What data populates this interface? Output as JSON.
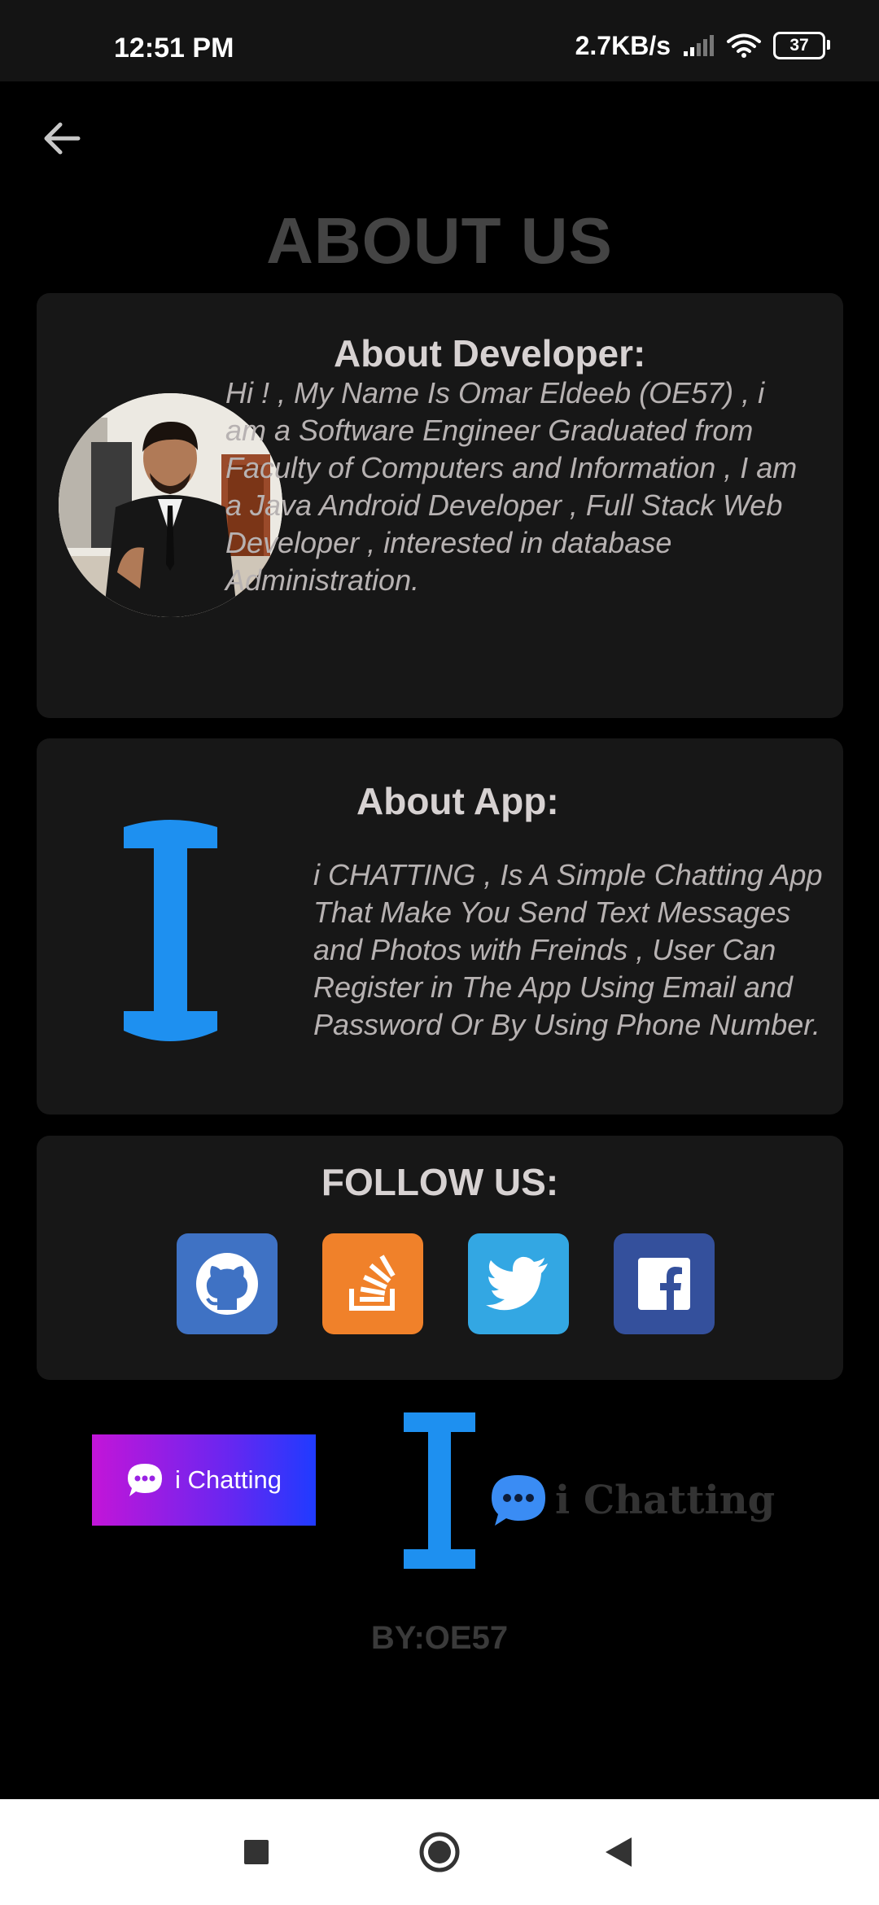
{
  "status": {
    "time": "12:51 PM",
    "net_speed": "2.7KB/s",
    "battery": "37"
  },
  "page": {
    "title": "ABOUT US"
  },
  "developer": {
    "heading": "About Developer:",
    "bio": "Hi ! , My Name Is Omar Eldeeb (OE57) , i am a Software Engineer Graduated from Faculty of Computers and Information , I am a Java Android Developer  , Full Stack Web Developer , interested in database Administration."
  },
  "app": {
    "heading": "About App:",
    "description": "i CHATTING ,  Is A Simple Chatting App That Make You Send  Text Messages and Photos with Freinds , User Can Register in The App Using Email and Password Or By Using Phone Number."
  },
  "follow": {
    "heading": "FOLLOW US:",
    "links": [
      {
        "name": "github",
        "icon": "github-icon",
        "color": "#3f72c4"
      },
      {
        "name": "stackoverflow",
        "icon": "stackoverflow-icon",
        "color": "#f0812a"
      },
      {
        "name": "twitter",
        "icon": "twitter-icon",
        "color": "#33a7e3"
      },
      {
        "name": "facebook",
        "icon": "facebook-icon",
        "color": "#34509c"
      }
    ]
  },
  "branding": {
    "badge_label": "i Chatting",
    "brand_name": "i Chatting",
    "byline": "BY:OE57"
  },
  "colors": {
    "accent": "#1e90f0",
    "card_bg": "#171717",
    "title": "#444444"
  }
}
